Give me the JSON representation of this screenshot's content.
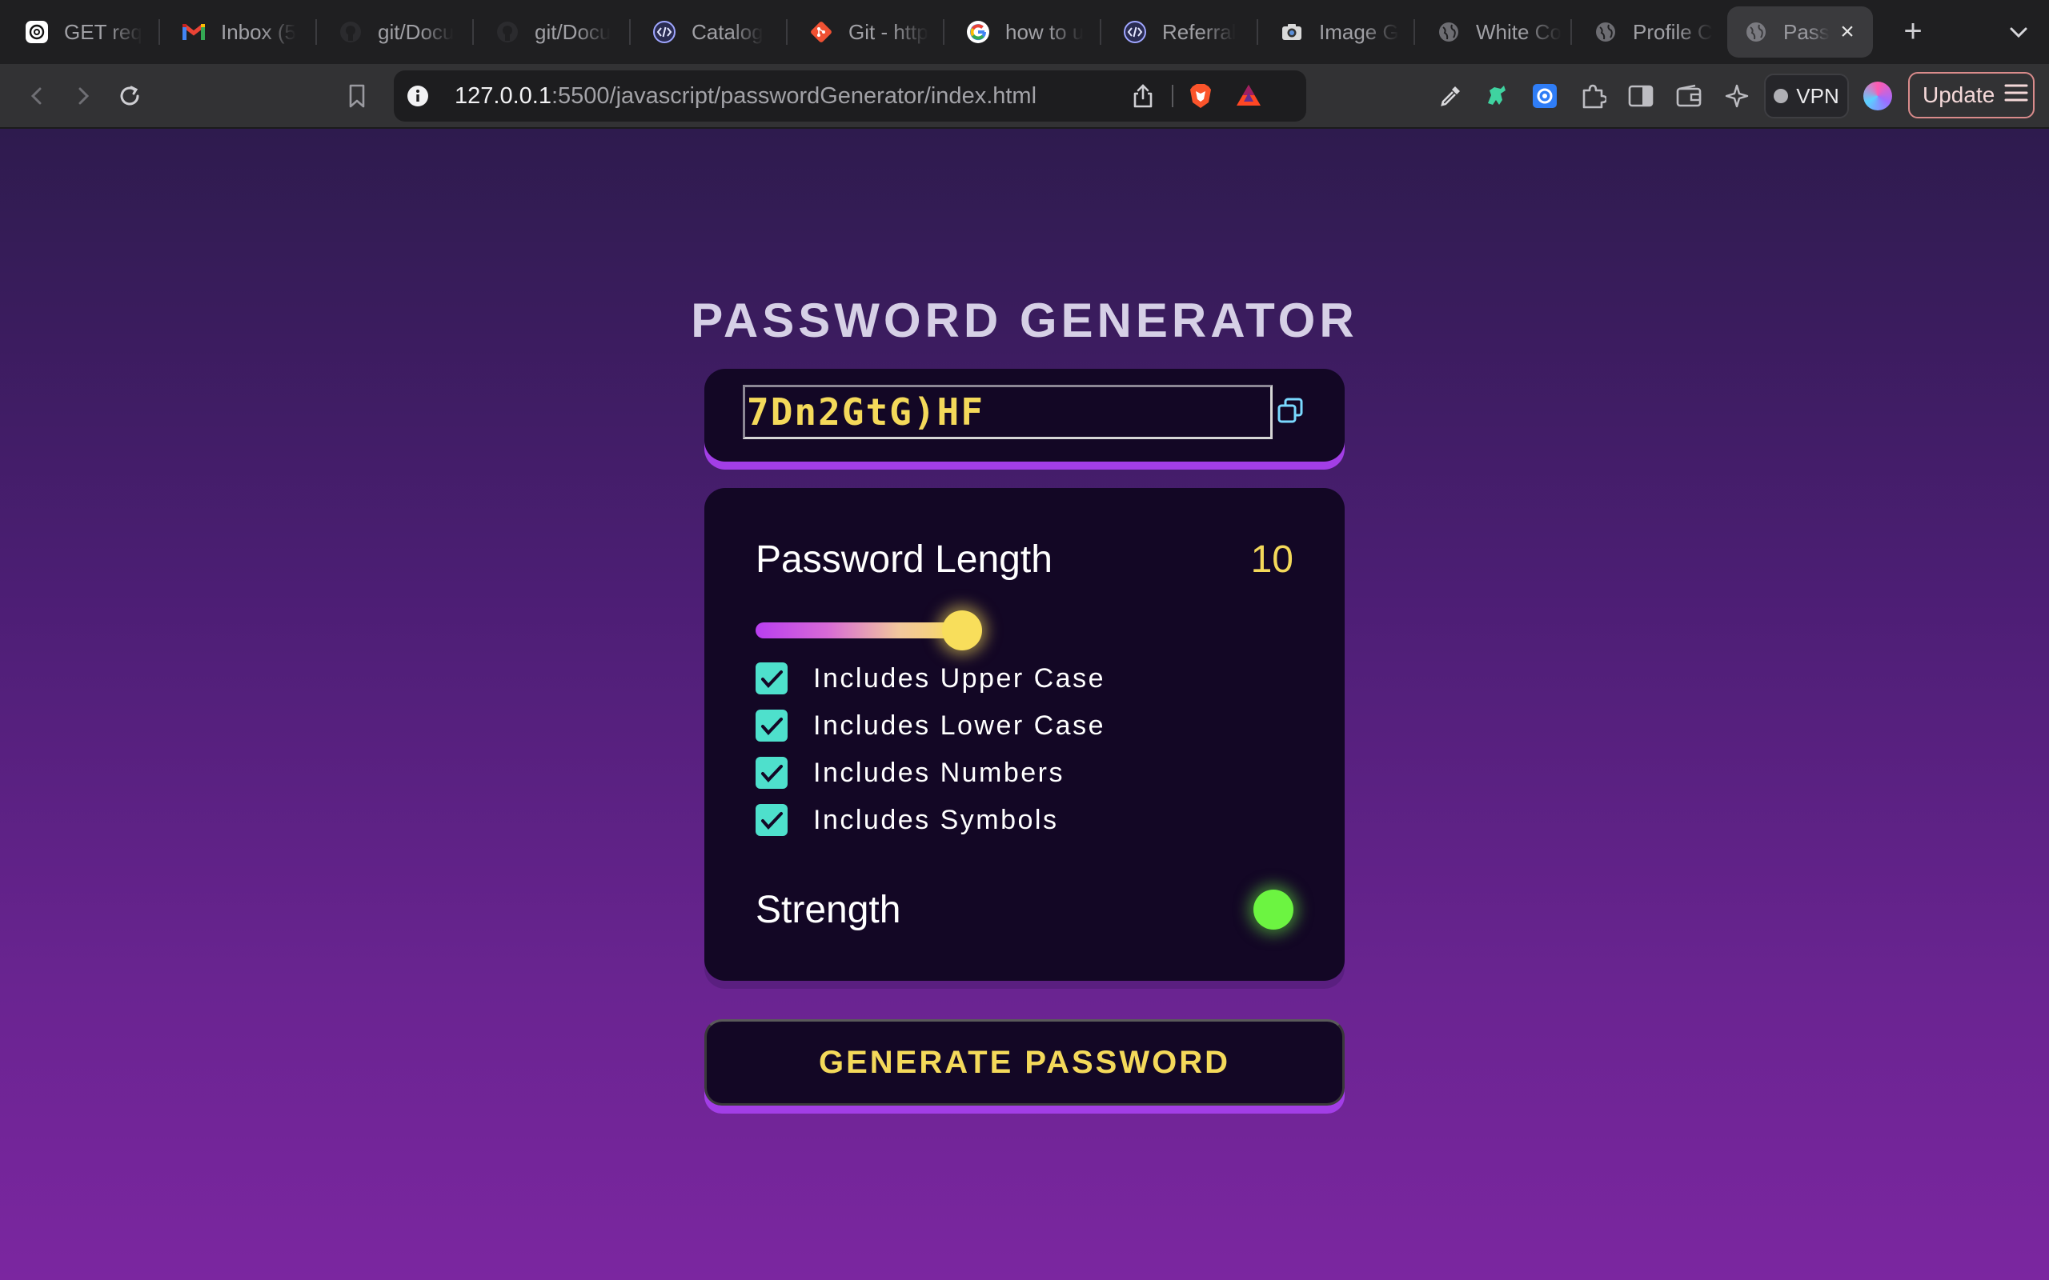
{
  "browser": {
    "tabs": [
      {
        "title": "GET req",
        "icon": "chatgpt-icon"
      },
      {
        "title": "Inbox (5",
        "icon": "gmail-icon"
      },
      {
        "title": "git/Docu",
        "icon": "github-icon"
      },
      {
        "title": "git/Docu",
        "icon": "github-icon"
      },
      {
        "title": "Catalog",
        "icon": "code-icon"
      },
      {
        "title": "Git - http",
        "icon": "git-icon"
      },
      {
        "title": "how to u",
        "icon": "google-icon"
      },
      {
        "title": "Referral",
        "icon": "code-icon"
      },
      {
        "title": "Image G",
        "icon": "image-icon"
      },
      {
        "title": "White Co",
        "icon": "globe-icon"
      },
      {
        "title": "Profile C",
        "icon": "globe-icon"
      },
      {
        "title": "Pass",
        "icon": "globe-icon",
        "active": true
      }
    ],
    "address": {
      "host": "127.0.0.1",
      "rest": ":5500/javascript/passwordGenerator/index.html"
    },
    "vpn_label": "VPN",
    "update_label": "Update"
  },
  "app": {
    "title": "PASSWORD GENERATOR",
    "password": "7Dn2GtG)HF",
    "length_label": "Password Length",
    "length_value": "10",
    "slider_fraction": 0.5,
    "options": [
      {
        "label": "Includes Upper Case",
        "checked": true
      },
      {
        "label": "Includes Lower Case",
        "checked": true
      },
      {
        "label": "Includes Numbers",
        "checked": true
      },
      {
        "label": "Includes Symbols",
        "checked": true
      }
    ],
    "strength_label": "Strength",
    "strength_color": "#6cf441",
    "generate_label": "GENERATE PASSWORD"
  }
}
